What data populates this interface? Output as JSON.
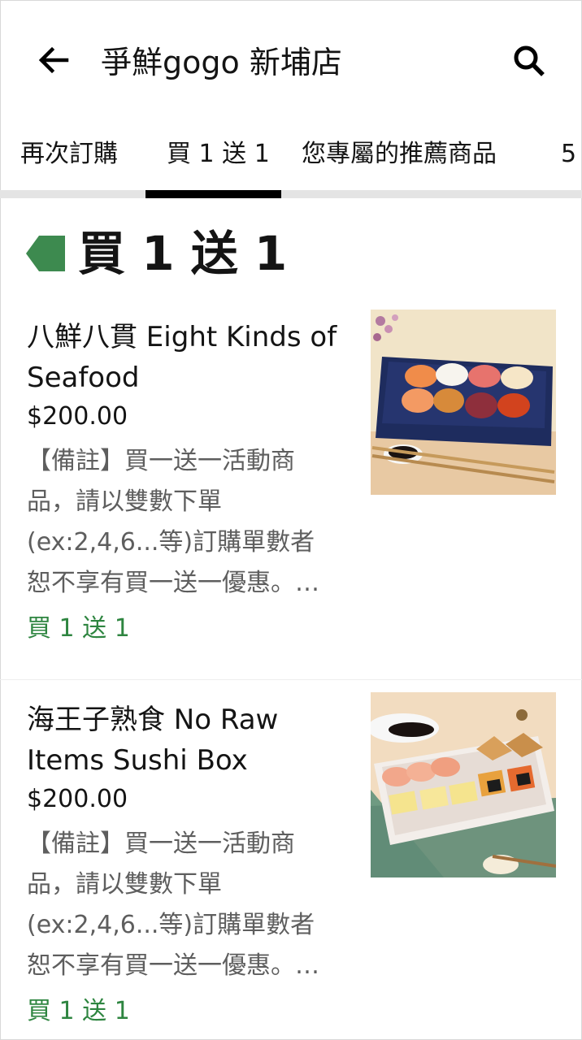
{
  "header": {
    "store_name": "爭鮮gogo 新埔店",
    "back_icon": "arrow-left-icon",
    "search_icon": "search-icon"
  },
  "tabs": [
    {
      "label": "再次訂購",
      "active": false
    },
    {
      "label": "買 1 送 1",
      "active": true
    },
    {
      "label": "您專屬的推薦商品",
      "active": false
    },
    {
      "label": "5",
      "active": false
    }
  ],
  "section": {
    "title": "買 1 送 1",
    "tag_color": "#3d8a4f"
  },
  "items": [
    {
      "name": "八鮮八貫 Eight Kinds of Seafood",
      "price": "$200.00",
      "description": "【備註】買一送一活動商品，請以雙數下單(ex:2,4,6...等)訂購單數者恕不享有買一送一優惠。含...",
      "promo": "買 1 送 1",
      "image": "sushi-platter-photo"
    },
    {
      "name": "海王子熟食 No Raw Items Sushi Box",
      "price": "$200.00",
      "description": "【備註】買一送一活動商品，請以雙數下單(ex:2,4,6...等)訂購單數者恕不享有買一送一優惠。含...",
      "promo": "買 1 送 1",
      "image": "cooked-sushi-box-photo"
    }
  ],
  "colors": {
    "promo_green": "#2e8540",
    "text": "#141414",
    "muted": "#5e5e5e",
    "tab_indicator": "#000000"
  }
}
